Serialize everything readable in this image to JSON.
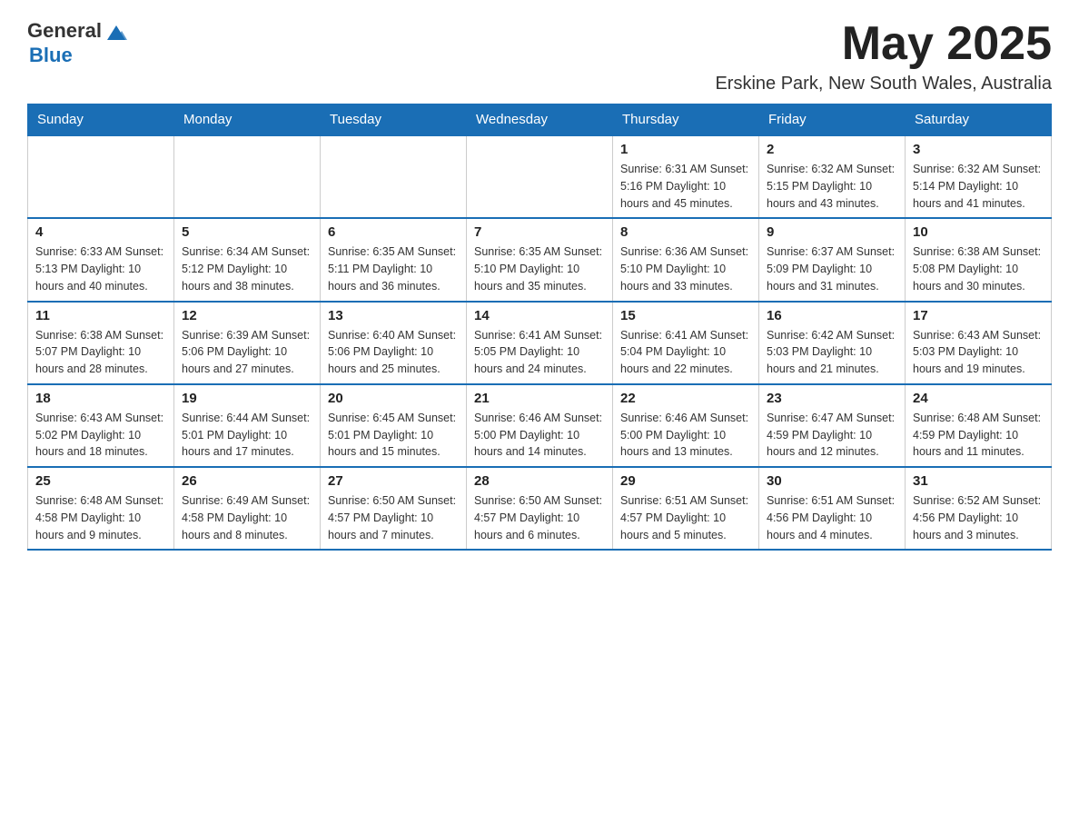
{
  "header": {
    "logo_text_general": "General",
    "logo_text_blue": "Blue",
    "month_title": "May 2025",
    "location": "Erskine Park, New South Wales, Australia"
  },
  "days_of_week": [
    "Sunday",
    "Monday",
    "Tuesday",
    "Wednesday",
    "Thursday",
    "Friday",
    "Saturday"
  ],
  "weeks": [
    [
      {
        "day": "",
        "info": ""
      },
      {
        "day": "",
        "info": ""
      },
      {
        "day": "",
        "info": ""
      },
      {
        "day": "",
        "info": ""
      },
      {
        "day": "1",
        "info": "Sunrise: 6:31 AM\nSunset: 5:16 PM\nDaylight: 10 hours and 45 minutes."
      },
      {
        "day": "2",
        "info": "Sunrise: 6:32 AM\nSunset: 5:15 PM\nDaylight: 10 hours and 43 minutes."
      },
      {
        "day": "3",
        "info": "Sunrise: 6:32 AM\nSunset: 5:14 PM\nDaylight: 10 hours and 41 minutes."
      }
    ],
    [
      {
        "day": "4",
        "info": "Sunrise: 6:33 AM\nSunset: 5:13 PM\nDaylight: 10 hours and 40 minutes."
      },
      {
        "day": "5",
        "info": "Sunrise: 6:34 AM\nSunset: 5:12 PM\nDaylight: 10 hours and 38 minutes."
      },
      {
        "day": "6",
        "info": "Sunrise: 6:35 AM\nSunset: 5:11 PM\nDaylight: 10 hours and 36 minutes."
      },
      {
        "day": "7",
        "info": "Sunrise: 6:35 AM\nSunset: 5:10 PM\nDaylight: 10 hours and 35 minutes."
      },
      {
        "day": "8",
        "info": "Sunrise: 6:36 AM\nSunset: 5:10 PM\nDaylight: 10 hours and 33 minutes."
      },
      {
        "day": "9",
        "info": "Sunrise: 6:37 AM\nSunset: 5:09 PM\nDaylight: 10 hours and 31 minutes."
      },
      {
        "day": "10",
        "info": "Sunrise: 6:38 AM\nSunset: 5:08 PM\nDaylight: 10 hours and 30 minutes."
      }
    ],
    [
      {
        "day": "11",
        "info": "Sunrise: 6:38 AM\nSunset: 5:07 PM\nDaylight: 10 hours and 28 minutes."
      },
      {
        "day": "12",
        "info": "Sunrise: 6:39 AM\nSunset: 5:06 PM\nDaylight: 10 hours and 27 minutes."
      },
      {
        "day": "13",
        "info": "Sunrise: 6:40 AM\nSunset: 5:06 PM\nDaylight: 10 hours and 25 minutes."
      },
      {
        "day": "14",
        "info": "Sunrise: 6:41 AM\nSunset: 5:05 PM\nDaylight: 10 hours and 24 minutes."
      },
      {
        "day": "15",
        "info": "Sunrise: 6:41 AM\nSunset: 5:04 PM\nDaylight: 10 hours and 22 minutes."
      },
      {
        "day": "16",
        "info": "Sunrise: 6:42 AM\nSunset: 5:03 PM\nDaylight: 10 hours and 21 minutes."
      },
      {
        "day": "17",
        "info": "Sunrise: 6:43 AM\nSunset: 5:03 PM\nDaylight: 10 hours and 19 minutes."
      }
    ],
    [
      {
        "day": "18",
        "info": "Sunrise: 6:43 AM\nSunset: 5:02 PM\nDaylight: 10 hours and 18 minutes."
      },
      {
        "day": "19",
        "info": "Sunrise: 6:44 AM\nSunset: 5:01 PM\nDaylight: 10 hours and 17 minutes."
      },
      {
        "day": "20",
        "info": "Sunrise: 6:45 AM\nSunset: 5:01 PM\nDaylight: 10 hours and 15 minutes."
      },
      {
        "day": "21",
        "info": "Sunrise: 6:46 AM\nSunset: 5:00 PM\nDaylight: 10 hours and 14 minutes."
      },
      {
        "day": "22",
        "info": "Sunrise: 6:46 AM\nSunset: 5:00 PM\nDaylight: 10 hours and 13 minutes."
      },
      {
        "day": "23",
        "info": "Sunrise: 6:47 AM\nSunset: 4:59 PM\nDaylight: 10 hours and 12 minutes."
      },
      {
        "day": "24",
        "info": "Sunrise: 6:48 AM\nSunset: 4:59 PM\nDaylight: 10 hours and 11 minutes."
      }
    ],
    [
      {
        "day": "25",
        "info": "Sunrise: 6:48 AM\nSunset: 4:58 PM\nDaylight: 10 hours and 9 minutes."
      },
      {
        "day": "26",
        "info": "Sunrise: 6:49 AM\nSunset: 4:58 PM\nDaylight: 10 hours and 8 minutes."
      },
      {
        "day": "27",
        "info": "Sunrise: 6:50 AM\nSunset: 4:57 PM\nDaylight: 10 hours and 7 minutes."
      },
      {
        "day": "28",
        "info": "Sunrise: 6:50 AM\nSunset: 4:57 PM\nDaylight: 10 hours and 6 minutes."
      },
      {
        "day": "29",
        "info": "Sunrise: 6:51 AM\nSunset: 4:57 PM\nDaylight: 10 hours and 5 minutes."
      },
      {
        "day": "30",
        "info": "Sunrise: 6:51 AM\nSunset: 4:56 PM\nDaylight: 10 hours and 4 minutes."
      },
      {
        "day": "31",
        "info": "Sunrise: 6:52 AM\nSunset: 4:56 PM\nDaylight: 10 hours and 3 minutes."
      }
    ]
  ]
}
